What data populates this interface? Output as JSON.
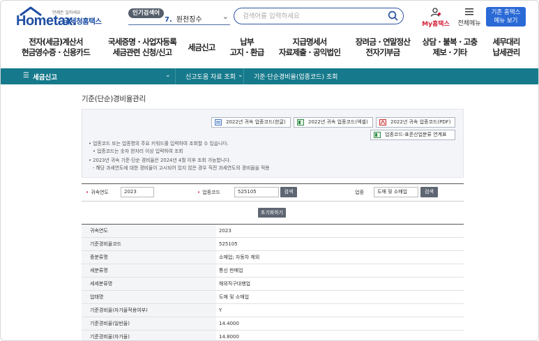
{
  "header": {
    "logo_text": "Hometax.",
    "logo_tagline": "언제든 일하세요",
    "site_name": "국세청홈택스",
    "popular_badge": "인기검색어",
    "popular_rank": "7.",
    "popular_term": "원천징수",
    "search_placeholder": "검색어를 입력하세요",
    "my_label": "My홈택스",
    "allmenu_label": "전체메뉴",
    "old_btn_line1": "기존 홈택스",
    "old_btn_line2": "메뉴 보기"
  },
  "gnb": [
    {
      "l1": "전자(세금)계산서",
      "l2": "현금영수증 · 신용카드"
    },
    {
      "l1": "국세증명 · 사업자등록",
      "l2": "세금관련 신청/신고"
    },
    {
      "l1": "세금신고",
      "l2": ""
    },
    {
      "l1": "납부",
      "l2": "고지 · 환급"
    },
    {
      "l1": "지급명세서",
      "l2": "자료제출 · 공익법인"
    },
    {
      "l1": "장려금 · 연말정산",
      "l2": "전자기부금"
    },
    {
      "l1": "상담 · 불복 · 고충",
      "l2": "제보 · 기타"
    },
    {
      "l1": "세무대리",
      "l2": "납세관리"
    }
  ],
  "breadcrumb": {
    "home": "세금신고",
    "level2": "신고도움 자료 조회",
    "level3": "기준·단순경비율(업종코드) 조회"
  },
  "page_title": "기준(단순)경비율관리",
  "downloads": {
    "hwp": "2022년 귀속 업종코드(한글)",
    "excel": "2022년 귀속 업종코드(엑셀)",
    "pdf": "2022년 귀속 업종코드(PDF)",
    "link": "업종코드-표준산업분류 연계표"
  },
  "notes": {
    "n1": "• 업종코드 또는 업종명의 주요 키워드를 입력하여 조회할 수 있습니다.",
    "n2": "• 업종코드는 숫자 한자리 이상 입력하여 조회",
    "n3": "• 2023년 귀속 기준·단순 경비율은 2024년 4월 이후 조회 가능합니다.",
    "n4": "- 해당 과세연도에 대한 경비율이 고시되어 있지 않은 경우 직전 과세연도의 경비율을 적용"
  },
  "search": {
    "year_label": "귀속연도",
    "year_value": "2023",
    "code_label": "업종코드",
    "code_value": "525105",
    "code_btn": "검색",
    "type_label": "업종",
    "type_value": "도매 및 소매업",
    "type_btn": "검색",
    "reset_btn": "초기화하기"
  },
  "result": [
    {
      "k": "귀속연도",
      "v": "2023"
    },
    {
      "k": "기준경비율코드",
      "v": "525105"
    },
    {
      "k": "중분류명",
      "v": "소매업; 자동차 제외"
    },
    {
      "k": "세분류명",
      "v": "통신 판매업"
    },
    {
      "k": "세세분류명",
      "v": "해외직구대행업"
    },
    {
      "k": "업태명",
      "v": "도매 및 소매업"
    },
    {
      "k": "기준경비율(자가율적용여부)",
      "v": "Y"
    },
    {
      "k": "기준경비율(일반율)",
      "v": "14.4000"
    },
    {
      "k": "기준경비율(자가율)",
      "v": "14.8000"
    }
  ]
}
